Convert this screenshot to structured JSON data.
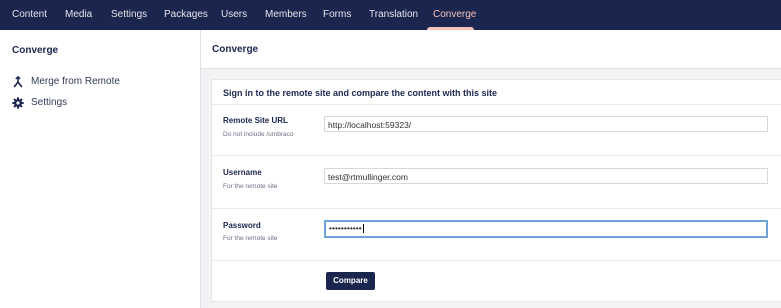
{
  "topnav": {
    "tabs": [
      {
        "label": "Content"
      },
      {
        "label": "Media"
      },
      {
        "label": "Settings"
      },
      {
        "label": "Packages"
      },
      {
        "label": "Users"
      },
      {
        "label": "Members"
      },
      {
        "label": "Forms"
      },
      {
        "label": "Translation"
      },
      {
        "label": "Converge",
        "active": true
      }
    ],
    "colors": {
      "background": "#1b264f",
      "active": "#f5c1bc",
      "text": "#e4e4ea"
    }
  },
  "sidebar": {
    "title": "Converge",
    "items": [
      {
        "label": "Merge from Remote",
        "icon": "merge-icon"
      },
      {
        "label": "Settings",
        "icon": "gear-icon"
      }
    ]
  },
  "header": {
    "title": "Converge"
  },
  "panel": {
    "title": "Sign in to the remote site and compare the content with this site",
    "fields": [
      {
        "label": "Remote Site URL",
        "description": "Do not include /umbraco",
        "value": "http://localhost:59323/"
      },
      {
        "label": "Username",
        "description": "For the remote site",
        "value": "test@rtmullinger.com"
      },
      {
        "label": "Password",
        "description": "For the remote site",
        "value": "•••••••••••"
      }
    ],
    "submit_label": "Compare"
  }
}
